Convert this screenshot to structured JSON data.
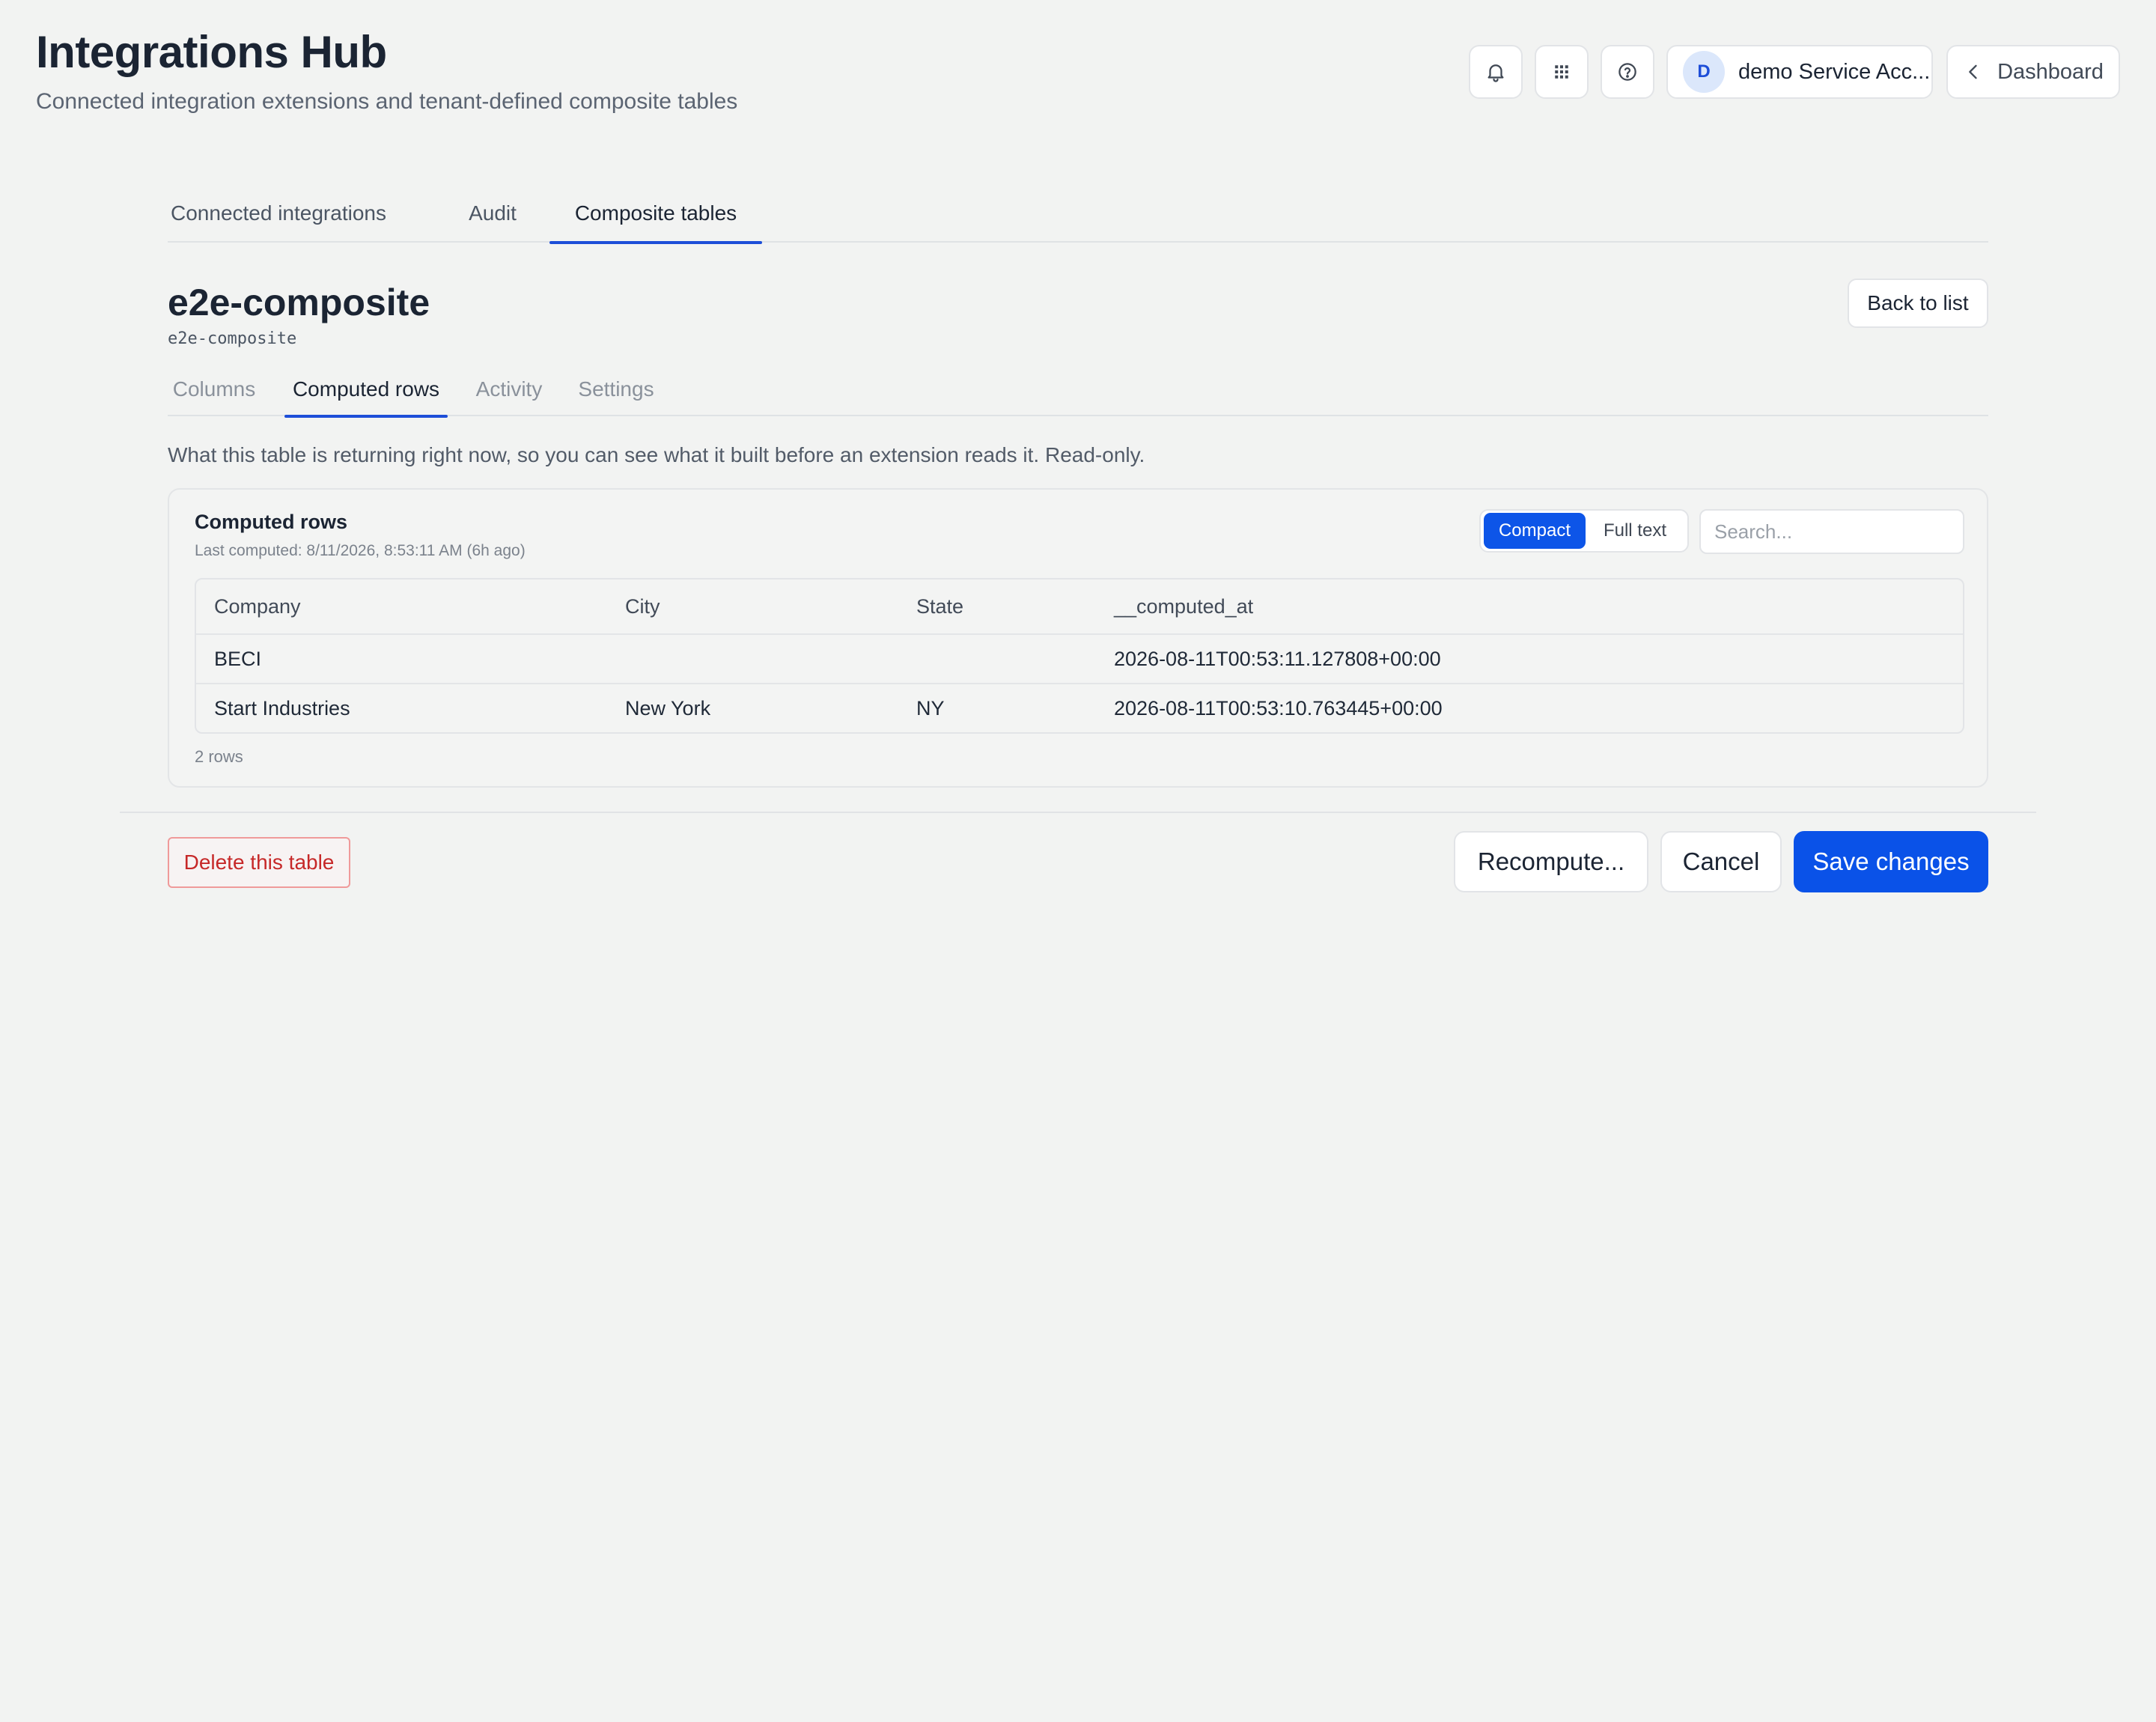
{
  "header": {
    "title": "Integrations Hub",
    "subtitle": "Connected integration extensions and tenant-defined composite tables",
    "icons": [
      "bell-icon",
      "apps-grid-icon",
      "help-icon"
    ],
    "account": {
      "initial": "D",
      "name": "demo Service Acc..."
    },
    "dashboard_label": "Dashboard"
  },
  "top_tabs": [
    {
      "label": "Connected integrations",
      "active": false
    },
    {
      "label": "Audit",
      "active": false
    },
    {
      "label": "Composite tables",
      "active": true
    }
  ],
  "table": {
    "name": "e2e-composite",
    "slug": "e2e-composite",
    "back_label": "Back to list"
  },
  "sub_tabs": [
    {
      "label": "Columns",
      "active": false
    },
    {
      "label": "Computed rows",
      "active": true
    },
    {
      "label": "Activity",
      "active": false
    },
    {
      "label": "Settings",
      "active": false
    }
  ],
  "description": "What this table is returning right now, so you can see what it built before an extension reads it. Read-only.",
  "computed": {
    "title": "Computed rows",
    "last_computed": "Last computed: 8/11/2026, 8:53:11 AM (6h ago)",
    "view_toggle": {
      "selected": "Compact",
      "options": [
        "Compact",
        "Full text"
      ]
    },
    "search_placeholder": "Search...",
    "columns": [
      "Company",
      "City",
      "State",
      "__computed_at"
    ],
    "rows": [
      [
        "BECI",
        "",
        "",
        "2026-08-11T00:53:11.127808+00:00"
      ],
      [
        "Start Industries",
        "New York",
        "NY",
        "2026-08-11T00:53:10.763445+00:00"
      ]
    ],
    "row_count": "2 rows"
  },
  "footer": {
    "delete_label": "Delete this table",
    "recompute_label": "Recompute...",
    "cancel_label": "Cancel",
    "save_label": "Save changes"
  },
  "colors": {
    "accent": "#0a52e8",
    "danger": "#c62828",
    "background": "#f2f3f2"
  }
}
